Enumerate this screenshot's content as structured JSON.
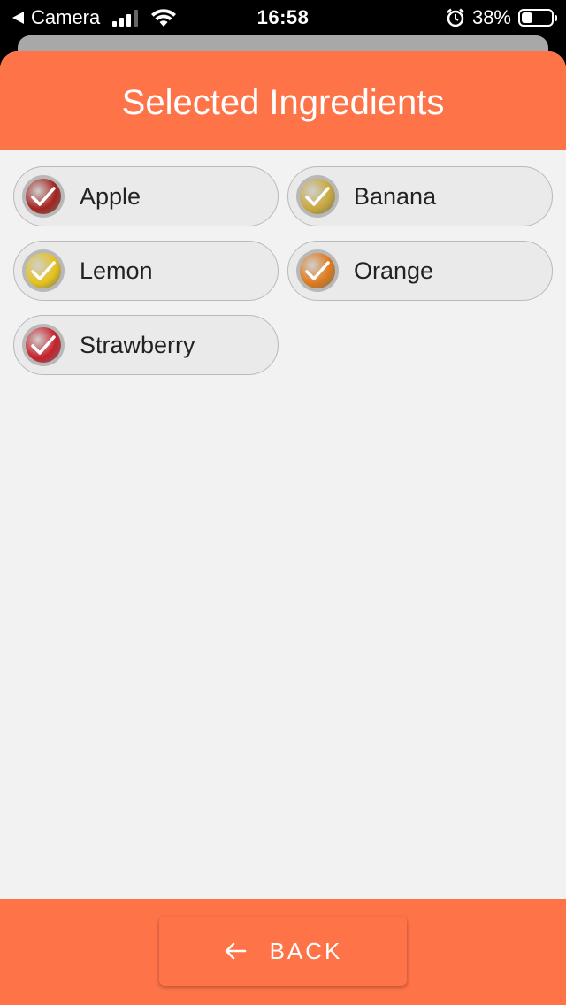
{
  "status_bar": {
    "back_app": "Camera",
    "time": "16:58",
    "battery_percent": "38%",
    "battery_level": 0.38,
    "signal_bars": 3
  },
  "header": {
    "title": "Selected Ingredients"
  },
  "ingredients": [
    {
      "label": "Apple",
      "selected": true,
      "color": "#a3231f"
    },
    {
      "label": "Banana",
      "selected": true,
      "color": "#c9a83a"
    },
    {
      "label": "Lemon",
      "selected": true,
      "color": "#e6c21a"
    },
    {
      "label": "Orange",
      "selected": true,
      "color": "#e07a1a"
    },
    {
      "label": "Strawberry",
      "selected": true,
      "color": "#c8202a"
    }
  ],
  "footer": {
    "back_label": "BACK"
  },
  "colors": {
    "accent": "#ff7349",
    "background": "#f2f2f2"
  }
}
